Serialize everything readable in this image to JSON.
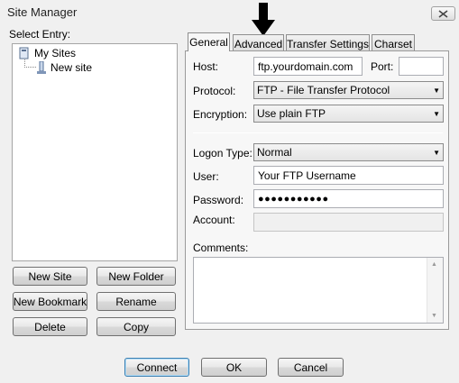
{
  "window": {
    "title": "Site Manager"
  },
  "icons": {
    "close": "close-icon",
    "sites_folder": "computer-sites-icon",
    "site": "site-server-icon",
    "pointer": "down-arrow-icon"
  },
  "left": {
    "select_entry_label": "Select Entry:",
    "tree": {
      "root": "My Sites",
      "child": "New site"
    }
  },
  "buttons": {
    "new_site": "New Site",
    "new_folder": "New Folder",
    "new_bookmark": "New Bookmark",
    "rename": "Rename",
    "delete": "Delete",
    "copy": "Copy",
    "connect": "Connect",
    "ok": "OK",
    "cancel": "Cancel"
  },
  "tabs": [
    "General",
    "Advanced",
    "Transfer Settings",
    "Charset"
  ],
  "active_tab": "General",
  "general": {
    "host_label": "Host:",
    "host_value": "ftp.yourdomain.com",
    "port_label": "Port:",
    "port_value": "",
    "protocol_label": "Protocol:",
    "protocol_value": "FTP - File Transfer Protocol",
    "encryption_label": "Encryption:",
    "encryption_value": "Use plain FTP",
    "logon_type_label": "Logon Type:",
    "logon_type_value": "Normal",
    "user_label": "User:",
    "user_value": "Your FTP Username",
    "password_label": "Password:",
    "password_value": "●●●●●●●●●●●",
    "account_label": "Account:",
    "account_value": "",
    "comments_label": "Comments:",
    "comments_value": ""
  }
}
